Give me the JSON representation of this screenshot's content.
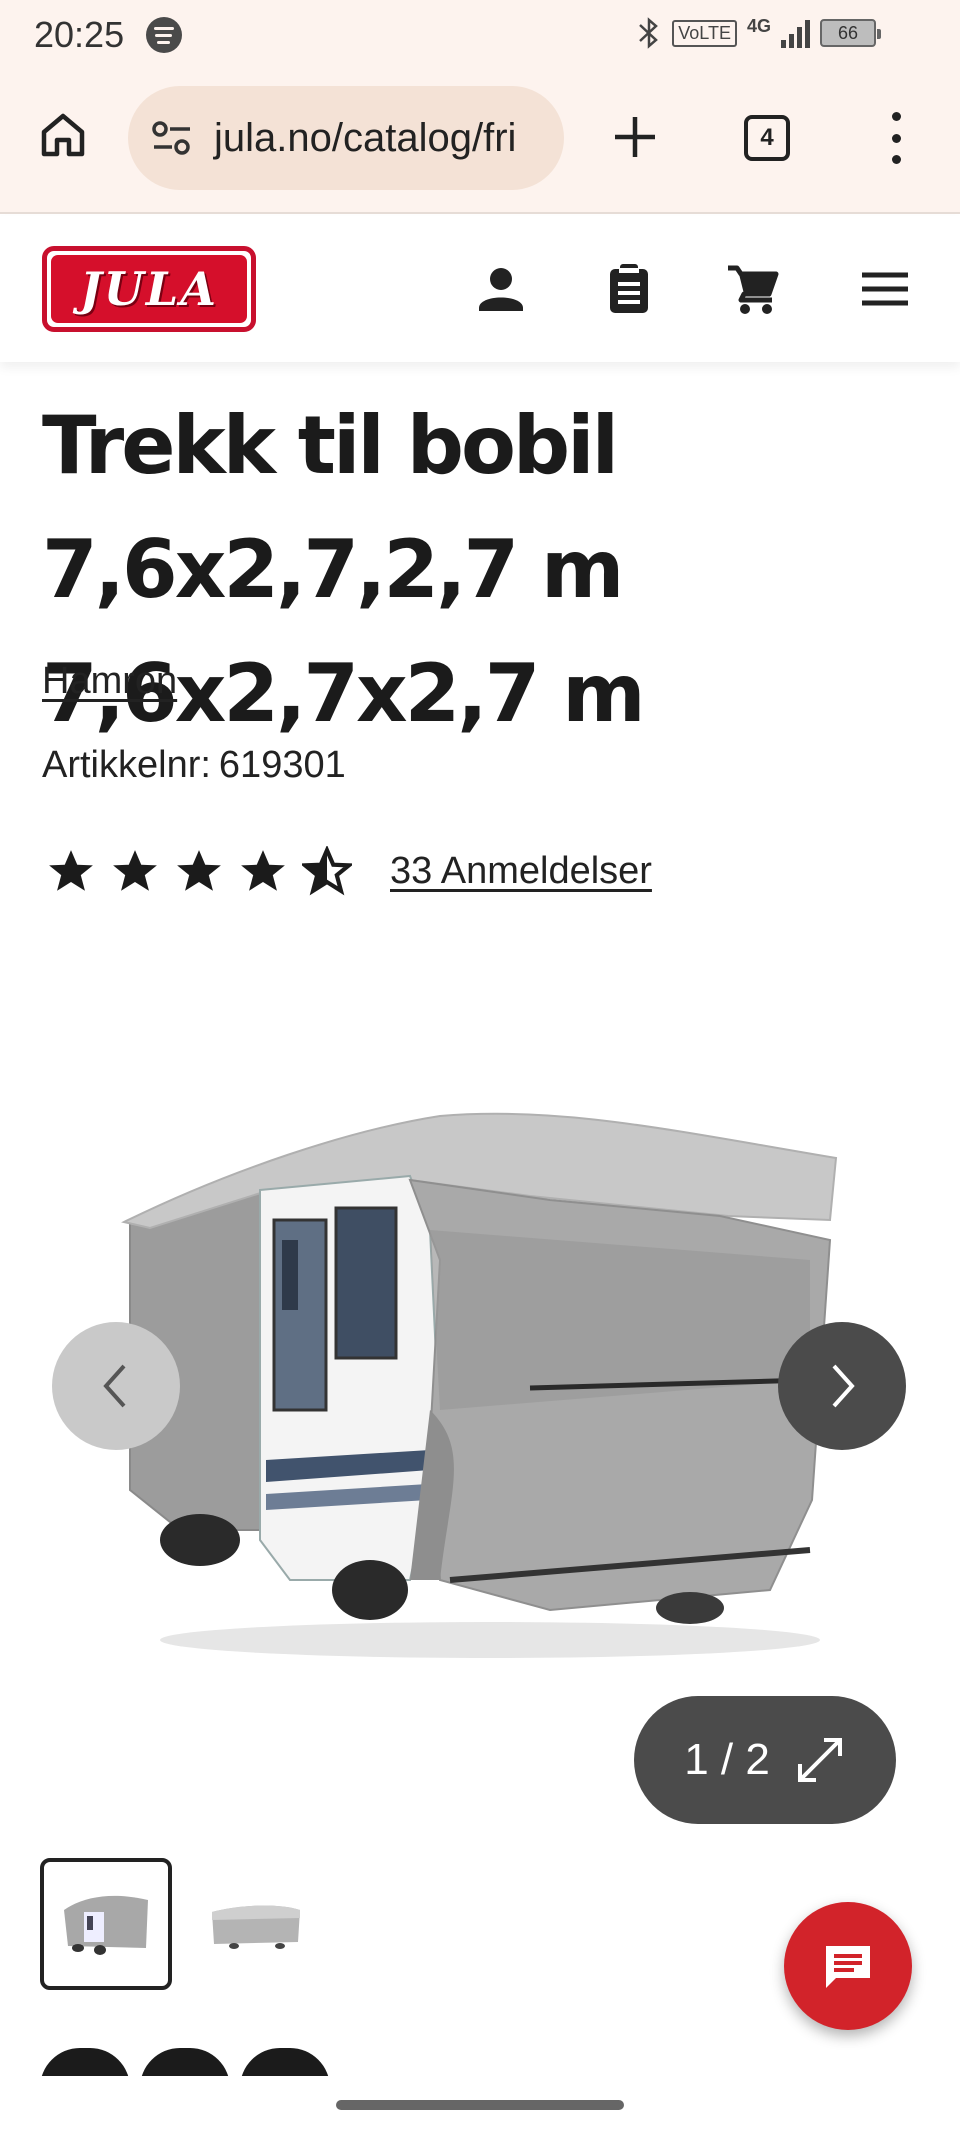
{
  "status_bar": {
    "time": "20:25",
    "volte": "VoLTE",
    "network": "4G",
    "battery": "66",
    "icons": [
      "spotify-icon",
      "bluetooth-icon",
      "signal-icon",
      "battery-icon"
    ]
  },
  "browser": {
    "url": "jula.no/catalog/fri",
    "tab_count": "4",
    "icons": [
      "home-icon",
      "tune-icon",
      "plus-icon",
      "more-vert-icon"
    ]
  },
  "header": {
    "logo_text": "JULA",
    "icons": [
      "account-icon",
      "clipboard-icon",
      "cart-icon",
      "menu-icon"
    ],
    "brand_color": "#d50f2b"
  },
  "product": {
    "title": "Trekk til bobil 7,6x2,7,2,7 m 7,6x2,7x2,7 m",
    "brand": "Hamron",
    "sku_label": "Artikkelnr:",
    "sku_value": "619301",
    "rating": 4.5,
    "rating_max": 5,
    "reviews": "33 Anmeldelser"
  },
  "gallery": {
    "counter": "1 / 2",
    "current": 1,
    "total": 2,
    "thumbnails": [
      "motorhome-cover-front",
      "motorhome-cover-side"
    ]
  },
  "chat": {
    "icon": "chat-icon",
    "color": "#d2232a"
  }
}
